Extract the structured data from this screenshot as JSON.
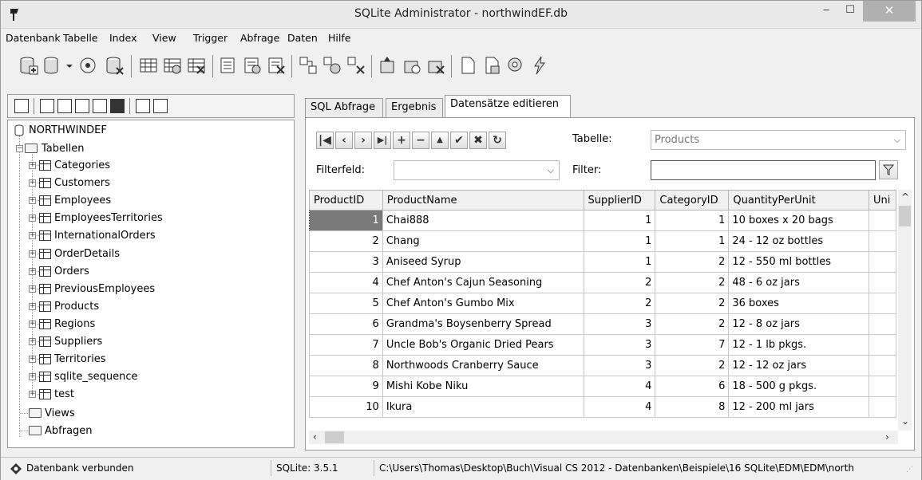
{
  "window": {
    "title": "SQLite Administrator - northwindEF.db",
    "controls": {
      "minimize": "‒",
      "maximize": "☐",
      "close": "✕"
    }
  },
  "menu": [
    "Datenbank",
    "Tabelle",
    "Index",
    "View",
    "Trigger",
    "Abfrage",
    "Daten",
    "Hilfe"
  ],
  "tree": {
    "root": "NORTHWINDEF",
    "tables_label": "Tabellen",
    "tables": [
      "Categories",
      "Customers",
      "Employees",
      "EmployeesTerritories",
      "InternationalOrders",
      "OrderDetails",
      "Orders",
      "PreviousEmployees",
      "Products",
      "Regions",
      "Suppliers",
      "Territories",
      "sqlite_sequence",
      "test"
    ],
    "views_label": "Views",
    "queries_label": "Abfragen"
  },
  "tabs": [
    "SQL Abfrage",
    "Ergebnis",
    "Datensätze editieren"
  ],
  "active_tab": "Datensätze editieren",
  "editor": {
    "table_label": "Tabelle:",
    "table_value": "Products",
    "filter_field_label": "Filterfeld:",
    "filter_field_value": "",
    "filter_label": "Filter:",
    "filter_value": ""
  },
  "nav_buttons": [
    "first",
    "prev",
    "next",
    "last",
    "insert",
    "delete",
    "up",
    "post",
    "cancel",
    "refresh"
  ],
  "grid": {
    "columns": [
      "ProductID",
      "ProductName",
      "SupplierID",
      "CategoryID",
      "QuantityPerUnit",
      "Uni"
    ],
    "rows": [
      [
        "1",
        "Chai888",
        "1",
        "1",
        "10 boxes x 20 bags",
        ""
      ],
      [
        "2",
        "Chang",
        "1",
        "1",
        "24 - 12 oz bottles",
        ""
      ],
      [
        "3",
        "Aniseed Syrup",
        "1",
        "2",
        "12 - 550 ml bottles",
        ""
      ],
      [
        "4",
        "Chef Anton's Cajun Seasoning",
        "2",
        "2",
        "48 - 6 oz jars",
        ""
      ],
      [
        "5",
        "Chef Anton's Gumbo Mix",
        "2",
        "2",
        "36 boxes",
        ""
      ],
      [
        "6",
        "Grandma's Boysenberry Spread",
        "3",
        "2",
        "12 - 8 oz jars",
        ""
      ],
      [
        "7",
        "Uncle Bob's Organic Dried Pears",
        "3",
        "7",
        "12 - 1 lb pkgs.",
        ""
      ],
      [
        "8",
        "Northwoods Cranberry Sauce",
        "3",
        "2",
        "12 - 12 oz jars",
        ""
      ],
      [
        "9",
        "Mishi Kobe Niku",
        "4",
        "6",
        "18 - 500 g pkgs.",
        ""
      ],
      [
        "10",
        "Ikura",
        "4",
        "8",
        "12 - 200 ml jars",
        ""
      ]
    ],
    "selected_row": 0
  },
  "status": {
    "connection": "Datenbank verbunden",
    "version": "SQLite: 3.5.1",
    "path": "C:\\Users\\Thomas\\Desktop\\Buch\\Visual CS 2012 - Datenbanken\\Beispiele\\16 SQLite\\EDM\\EDM\\north"
  }
}
